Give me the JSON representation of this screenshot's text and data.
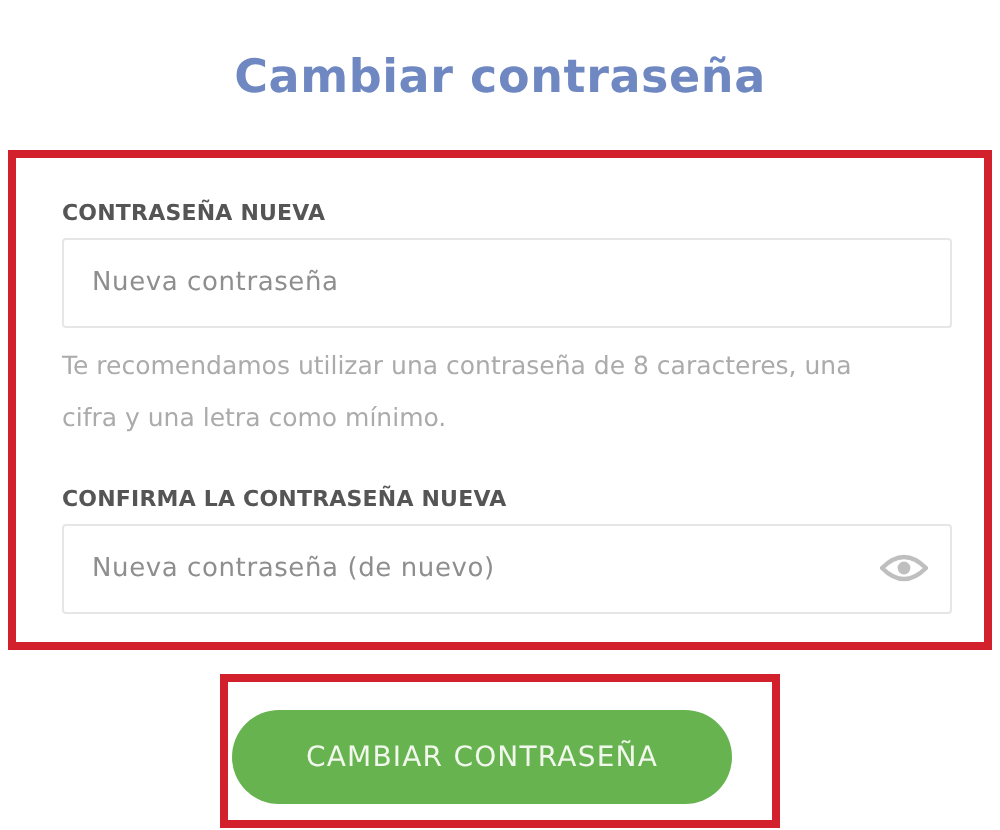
{
  "title": "Cambiar contraseña",
  "form": {
    "highlighted": true,
    "fields": [
      {
        "kind": "plain",
        "label": "CONTRASEÑA NUEVA",
        "placeholder": "Nueva contraseña",
        "hint": "Te recomendamos utilizar una contraseña de 8 caracteres, una cifra y una letra como mínimo."
      },
      {
        "kind": "reveal",
        "label": "CONFIRMA LA CONTRASEÑA NUEVA",
        "placeholder": "Nueva contraseña (de nuevo)"
      }
    ]
  },
  "submit": {
    "label": "CAMBIAR CONTRASEÑA",
    "highlighted": true
  }
}
